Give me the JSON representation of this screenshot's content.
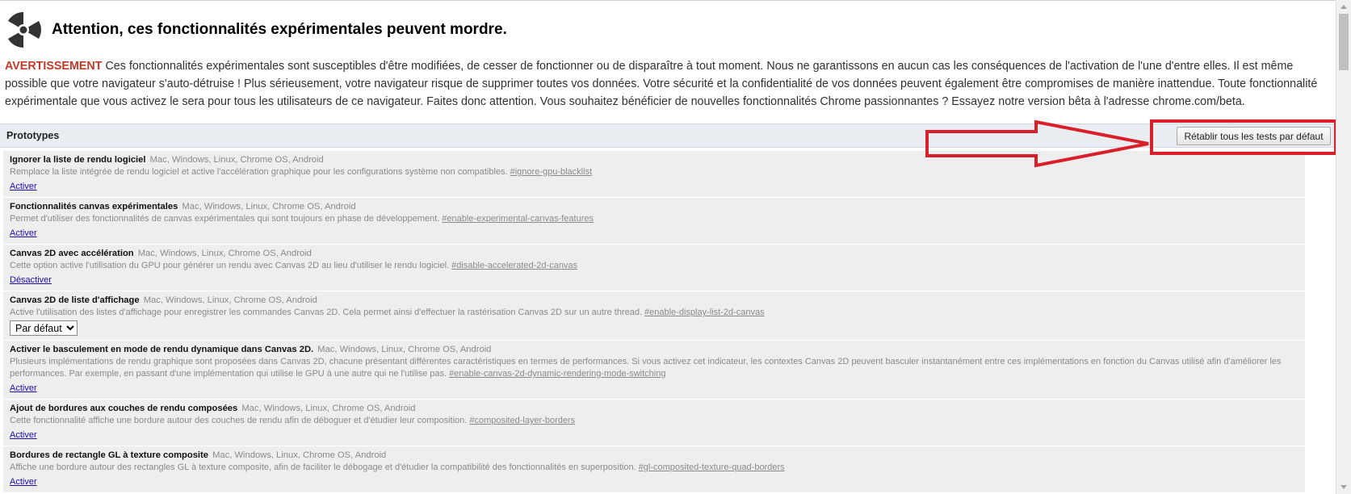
{
  "header": {
    "title": "Attention, ces fonctionnalités expérimentales peuvent mordre.",
    "icon": "radiation-warning-icon"
  },
  "warning": {
    "label": "AVERTISSEMENT",
    "text": "Ces fonctionnalités expérimentales sont susceptibles d'être modifiées, de cesser de fonctionner ou de disparaître à tout moment. Nous ne garantissons en aucun cas les conséquences de l'activation de l'une d'entre elles. Il est même possible que votre navigateur s'auto-détruise ! Plus sérieusement, votre navigateur risque de supprimer toutes vos données. Votre sécurité et la confidentialité de vos données peuvent également être compromises de manière inattendue. Toute fonctionnalité expérimentale que vous activez le sera pour tous les utilisateurs de ce navigateur. Faites donc attention. Vous souhaitez bénéficier de nouvelles fonctionnalités Chrome passionnantes ? Essayez notre version bêta à l'adresse chrome.com/beta.",
    "label_color": "#c53929"
  },
  "section": {
    "title": "Prototypes",
    "reset_label": "Rétablir tous les tests par défaut"
  },
  "experiments": [
    {
      "name": "Ignorer la liste de rendu logiciel",
      "platforms": "Mac, Windows, Linux, Chrome OS, Android",
      "description": "Remplace la liste intégrée de rendu logiciel et active l'accélération graphique pour les configurations système non compatibles.",
      "tag": "#ignore-gpu-blacklist",
      "action": "Activer"
    },
    {
      "name": "Fonctionnalités canvas expérimentales",
      "platforms": "Mac, Windows, Linux, Chrome OS, Android",
      "description": "Permet d'utiliser des fonctionnalités de canvas expérimentales qui sont toujours en phase de développement.",
      "tag": "#enable-experimental-canvas-features",
      "action": "Activer"
    },
    {
      "name": "Canvas 2D avec accélération",
      "platforms": "Mac, Windows, Linux, Chrome OS, Android",
      "description": "Cette option active l'utilisation du GPU pour générer un rendu avec Canvas 2D au lieu d'utiliser le rendu logiciel.",
      "tag": "#disable-accelerated-2d-canvas",
      "action": "Désactiver"
    },
    {
      "name": "Canvas 2D de liste d'affichage",
      "platforms": "Mac, Windows, Linux, Chrome OS, Android",
      "description": "Active l'utilisation des listes d'affichage pour enregistrer les commandes Canvas 2D. Cela permet ainsi d'effectuer la rastérisation Canvas 2D sur un autre thread.",
      "tag": "#enable-display-list-2d-canvas",
      "select_value": "Par défaut"
    },
    {
      "name": "Activer le basculement en mode de rendu dynamique dans Canvas 2D.",
      "platforms": "Mac, Windows, Linux, Chrome OS, Android",
      "description": "Plusieurs implémentations de rendu graphique sont proposées dans Canvas 2D, chacune présentant différentes caractéristiques en termes de performances. Si vous activez cet indicateur, les contextes Canvas 2D peuvent basculer instantanément entre ces implémentations en fonction du Canvas utilisé afin d'améliorer les performances. Par exemple, en passant d'une implémentation qui utilise le GPU à une autre qui ne l'utilise pas.",
      "tag": "#enable-canvas-2d-dynamic-rendering-mode-switching",
      "action": "Activer"
    },
    {
      "name": "Ajout de bordures aux couches de rendu composées",
      "platforms": "Mac, Windows, Linux, Chrome OS, Android",
      "description": "Cette fonctionnalité affiche une bordure autour des couches de rendu afin de déboguer et d'étudier leur composition.",
      "tag": "#composited-layer-borders",
      "action": "Activer"
    },
    {
      "name": "Bordures de rectangle GL à texture composite",
      "platforms": "Mac, Windows, Linux, Chrome OS, Android",
      "description": "Affiche une bordure autour des rectangles GL à texture composite, afin de faciliter le débogage et d'étudier la compatibilité des fonctionnalités en superposition.",
      "tag": "#gl-composited-texture-quad-borders",
      "action": "Activer"
    }
  ],
  "colors": {
    "annotation_red": "#d9202a",
    "link": "#1a0dab"
  }
}
